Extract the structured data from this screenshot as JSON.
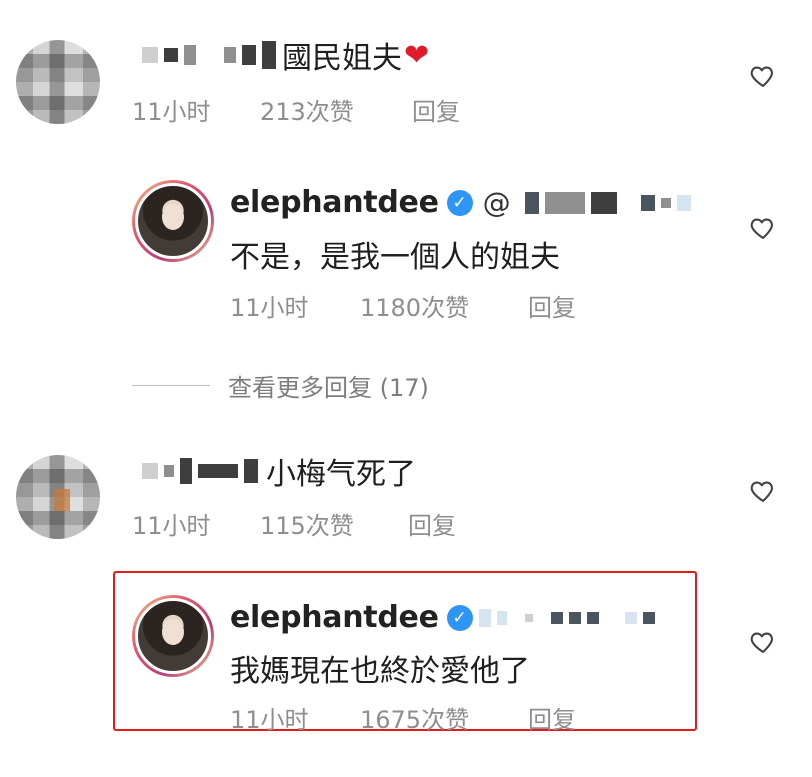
{
  "comments": [
    {
      "text": "國民姐夫",
      "emoji": "❤",
      "time": "11小时",
      "likes": "213次赞",
      "reply_label": "回复"
    },
    {
      "username": "elephantdee",
      "mention_prefix": "@",
      "text": "不是，是我一個人的姐夫",
      "time": "11小时",
      "likes": "1180次赞",
      "reply_label": "回复"
    },
    {
      "text": "小梅气死了",
      "time": "11小时",
      "likes": "115次赞",
      "reply_label": "回复"
    },
    {
      "username": "elephantdee",
      "text": "我媽現在也終於愛他了",
      "time": "11小时",
      "likes": "1675次赞",
      "reply_label": "回复"
    }
  ],
  "view_more": "查看更多回复 (17)",
  "colors": {
    "verified": "#2f95f5",
    "highlight_border": "#e21b1b",
    "meta_text": "#8e8e8e"
  },
  "icons": {
    "like": "heart-outline-icon",
    "verified": "verified-badge-icon"
  }
}
